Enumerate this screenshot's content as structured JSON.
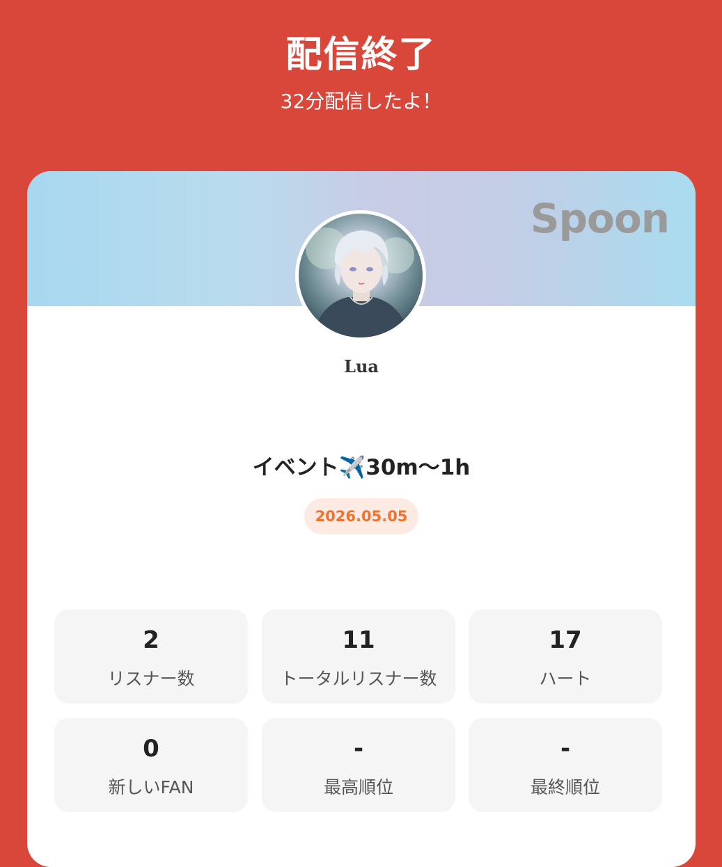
{
  "header": {
    "title": "配信終了",
    "subtitle": "32分配信したよ！"
  },
  "card": {
    "brand": "Spoon",
    "username": "Lua",
    "live_title": "イベント✈️30m〜1h",
    "date": "2026.05.05",
    "stats": [
      {
        "value": "2",
        "label": "リスナー数"
      },
      {
        "value": "11",
        "label": "トータルリスナー数"
      },
      {
        "value": "17",
        "label": "ハート"
      },
      {
        "value": "0",
        "label": "新しいFAN"
      },
      {
        "value": "-",
        "label": "最高順位"
      },
      {
        "value": "-",
        "label": "最終順位"
      }
    ]
  },
  "colors": {
    "background": "#d9473a",
    "date_text": "#f07331",
    "date_bg": "#fdebe3",
    "brand": "#9a9a9a"
  }
}
